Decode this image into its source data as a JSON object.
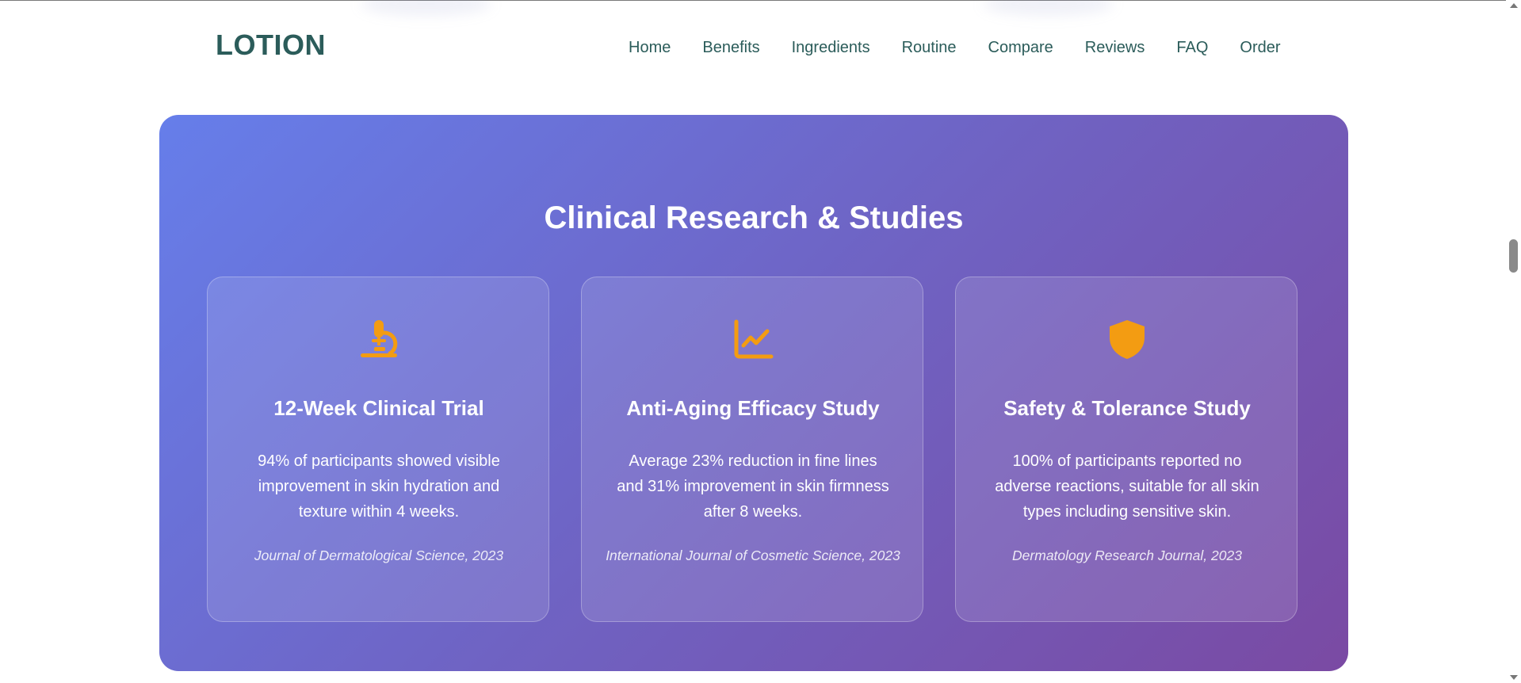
{
  "header": {
    "logo": "LOTION",
    "nav": [
      "Home",
      "Benefits",
      "Ingredients",
      "Routine",
      "Compare",
      "Reviews",
      "FAQ",
      "Order"
    ]
  },
  "research": {
    "title": "Clinical Research & Studies",
    "cards": [
      {
        "icon": "microscope-icon",
        "title": "12-Week Clinical Trial",
        "description": "94% of participants showed visible improvement in skin hydration and texture within 4 weeks.",
        "citation": "Journal of Dermatological Science, 2023"
      },
      {
        "icon": "chart-line-icon",
        "title": "Anti-Aging Efficacy Study",
        "description": "Average 23% reduction in fine lines and 31% improvement in skin firmness after 8 weeks.",
        "citation": "International Journal of Cosmetic Science, 2023"
      },
      {
        "icon": "shield-icon",
        "title": "Safety & Tolerance Study",
        "description": "100% of participants reported no adverse reactions, suitable for all skin types including sensitive skin.",
        "citation": "Dermatology Research Journal, 2023"
      }
    ]
  },
  "colors": {
    "brand": "#2b5c5a",
    "icon_accent": "#f39c12",
    "gradient_start": "#667eea",
    "gradient_end": "#7a4aa3"
  }
}
